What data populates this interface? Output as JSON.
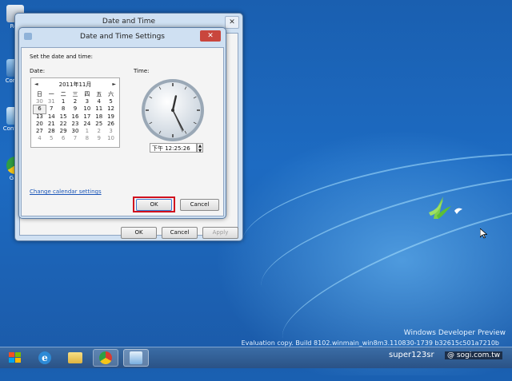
{
  "desktop": {
    "icons": [
      {
        "label": "Rec"
      },
      {
        "label": "Con Sh"
      },
      {
        "label": "Cont - St"
      },
      {
        "label": "G Cl"
      }
    ],
    "watermark": {
      "title": "Windows Developer Preview",
      "build": "Evaluation copy. Build 8102.winmain_win8m3.110830-1739 b32615c501a7210b"
    },
    "credit": {
      "author": "super123sr",
      "site": "@ sogi.com.tw"
    }
  },
  "outer_window": {
    "title": "Date and Time",
    "buttons": {
      "ok": "OK",
      "cancel": "Cancel",
      "apply": "Apply"
    }
  },
  "dialog": {
    "title": "Date and Time Settings",
    "instruction": "Set the date and time:",
    "date_label": "Date:",
    "time_label": "Time:",
    "calendar": {
      "month_label": "2011年11月",
      "prev": "◄",
      "next": "►",
      "weekdays": [
        "日",
        "一",
        "二",
        "三",
        "四",
        "五",
        "六"
      ],
      "days": [
        {
          "d": "30",
          "dim": true
        },
        {
          "d": "31",
          "dim": true
        },
        {
          "d": "1"
        },
        {
          "d": "2"
        },
        {
          "d": "3"
        },
        {
          "d": "4"
        },
        {
          "d": "5"
        },
        {
          "d": "6",
          "sel": true
        },
        {
          "d": "7"
        },
        {
          "d": "8"
        },
        {
          "d": "9"
        },
        {
          "d": "10"
        },
        {
          "d": "11"
        },
        {
          "d": "12"
        },
        {
          "d": "13"
        },
        {
          "d": "14"
        },
        {
          "d": "15"
        },
        {
          "d": "16"
        },
        {
          "d": "17"
        },
        {
          "d": "18"
        },
        {
          "d": "19"
        },
        {
          "d": "20"
        },
        {
          "d": "21"
        },
        {
          "d": "22"
        },
        {
          "d": "23"
        },
        {
          "d": "24"
        },
        {
          "d": "25"
        },
        {
          "d": "26"
        },
        {
          "d": "27"
        },
        {
          "d": "28"
        },
        {
          "d": "29"
        },
        {
          "d": "30"
        },
        {
          "d": "1",
          "dim": true
        },
        {
          "d": "2",
          "dim": true
        },
        {
          "d": "3",
          "dim": true
        },
        {
          "d": "4",
          "dim": true
        },
        {
          "d": "5",
          "dim": true
        },
        {
          "d": "6",
          "dim": true
        },
        {
          "d": "7",
          "dim": true
        },
        {
          "d": "8",
          "dim": true
        },
        {
          "d": "9",
          "dim": true
        },
        {
          "d": "10",
          "dim": true
        }
      ]
    },
    "clock": {
      "hours": 12,
      "minutes": 25,
      "seconds": 26
    },
    "time_value": "下午 12:25:26",
    "change_calendar_link": "Change calendar settings",
    "buttons": {
      "ok": "OK",
      "cancel": "Cancel"
    },
    "highlight_color": "#d0101e"
  }
}
